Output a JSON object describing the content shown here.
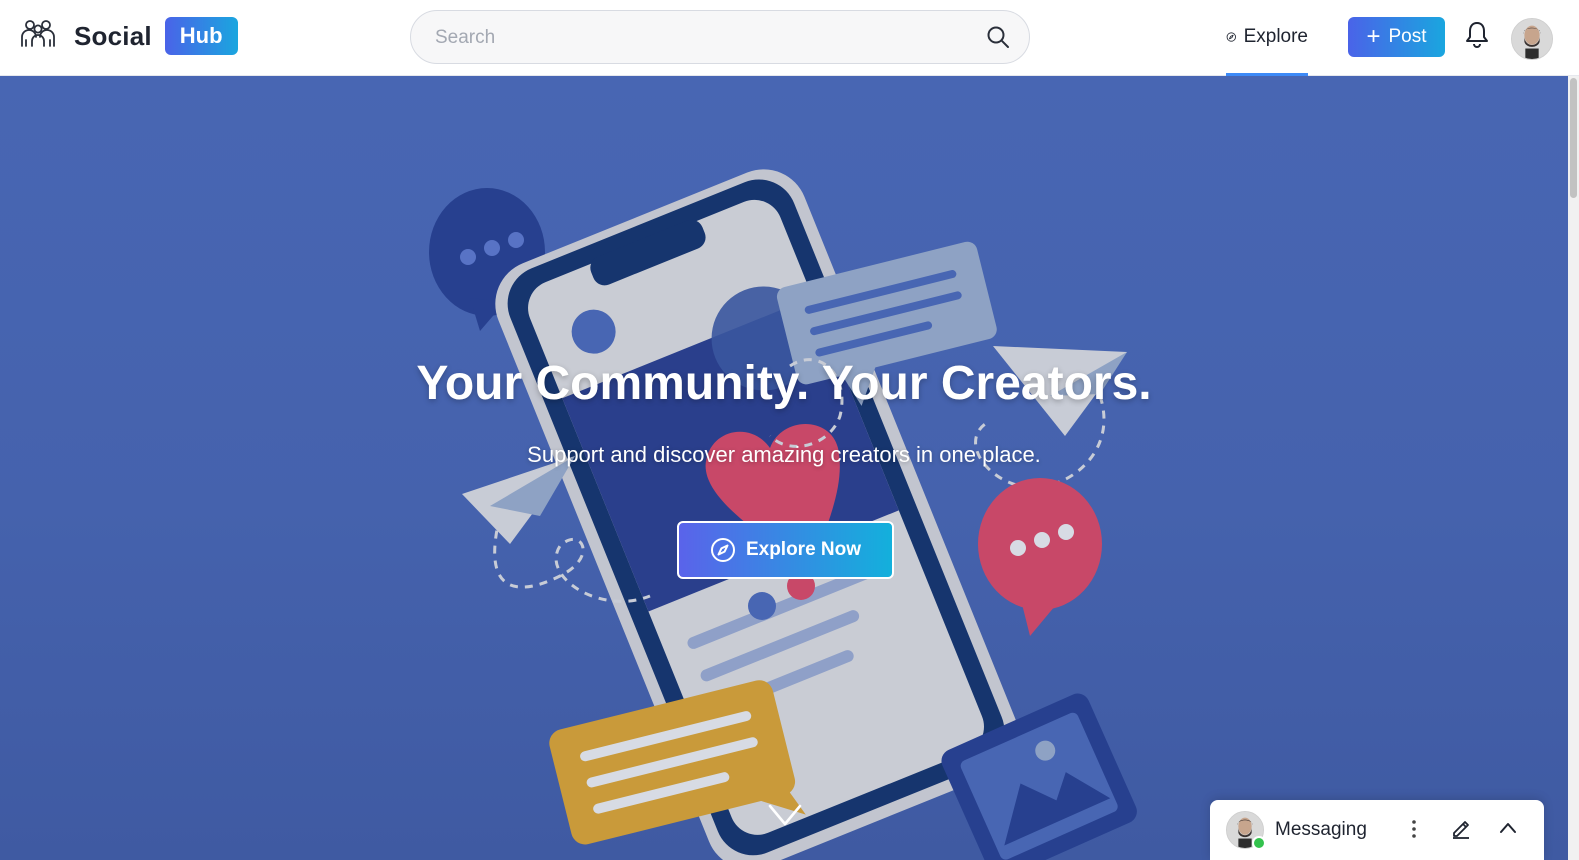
{
  "header": {
    "brand_name": "Social",
    "brand_badge": "Hub",
    "search_placeholder": "Search",
    "nav_explore_label": "Explore",
    "post_button_label": "Post",
    "icons": [
      "community-icon",
      "search-icon",
      "compass-icon",
      "plus-icon",
      "bell-icon",
      "avatar"
    ]
  },
  "hero": {
    "title": "Your Community. Your Creators.",
    "subtitle": "Support and discover amazing creators in one place.",
    "cta_label": "Explore Now",
    "icons": [
      "compass-icon",
      "chevron-down-icon"
    ]
  },
  "messaging": {
    "title": "Messaging",
    "icons": [
      "avatar",
      "more-vertical-icon",
      "compose-icon",
      "chevron-up-icon"
    ],
    "status": "online"
  },
  "colors": {
    "accent_gradient_start": "#4a63e8",
    "accent_gradient_end": "#1aa6df",
    "hero_background": "#4866b3",
    "active_tab_underline": "#3d8af7",
    "online": "#33c24d"
  }
}
